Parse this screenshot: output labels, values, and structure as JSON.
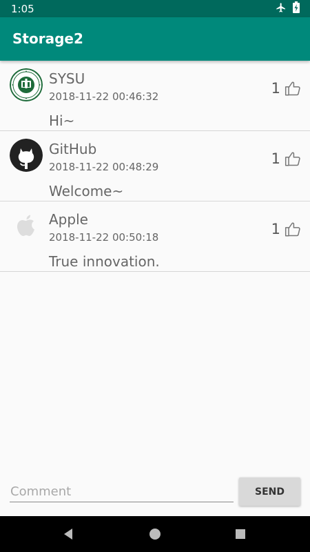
{
  "status_bar": {
    "time": "1:05",
    "icons": [
      "airplane-icon",
      "battery-charging-icon"
    ]
  },
  "app_bar": {
    "title": "Storage2"
  },
  "comments": [
    {
      "avatar": "sysu-logo",
      "name": "SYSU",
      "time": "2018-11-22 00:46:32",
      "message": "Hi~",
      "likes": "1"
    },
    {
      "avatar": "github-icon",
      "name": "GitHub",
      "time": "2018-11-22 00:48:29",
      "message": "Welcome~",
      "likes": "1"
    },
    {
      "avatar": "apple-icon",
      "name": "Apple",
      "time": "2018-11-22 00:50:18",
      "message": "True innovation.",
      "likes": "1"
    }
  ],
  "composer": {
    "placeholder": "Comment",
    "send_label": "SEND"
  },
  "colors": {
    "status_bar": "#00695c",
    "app_bar": "#00897b",
    "background": "#fafafa"
  }
}
